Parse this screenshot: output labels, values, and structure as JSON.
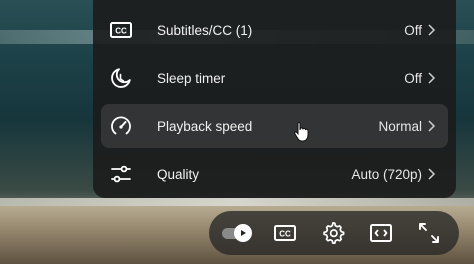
{
  "settings_menu": {
    "items": [
      {
        "icon": "subtitles-icon",
        "label": "Subtitles/CC (1)",
        "value": "Off"
      },
      {
        "icon": "sleep-timer-icon",
        "label": "Sleep timer",
        "value": "Off"
      },
      {
        "icon": "playback-speed-icon",
        "label": "Playback speed",
        "value": "Normal",
        "hovered": true
      },
      {
        "icon": "quality-icon",
        "label": "Quality",
        "value": "Auto (720p)"
      }
    ]
  },
  "control_bar": {
    "autoplay": {
      "icon": "autoplay-toggle-icon",
      "on": true
    },
    "buttons": [
      {
        "icon": "subtitles-icon"
      },
      {
        "icon": "settings-gear-icon"
      },
      {
        "icon": "theater-mode-icon"
      },
      {
        "icon": "fullscreen-icon"
      }
    ]
  },
  "colors": {
    "menu_bg": "#1c1c1c",
    "text": "#ffffff"
  }
}
